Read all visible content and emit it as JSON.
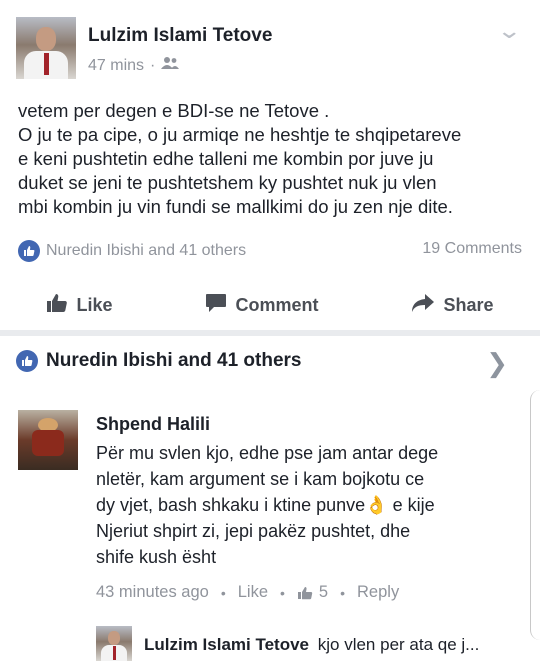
{
  "post": {
    "author": "Lulzim Islami Tetove",
    "time": "47 mins",
    "separator": "·",
    "text_lines": [
      "vetem per degen e BDI-se ne Tetove .",
      "O ju te pa cipe, o ju armiqe ne heshtje te shqipetareve",
      "e keni pushtetin edhe talleni me kombin por juve ju",
      "duket se jeni te pushtetshem   ky pushtet nuk ju vlen",
      "mbi kombin ju vin fundi se mallkimi do ju zen nje dite."
    ],
    "reactions_text": "Nuredin Ibishi and 41 others",
    "comments_count": "19 Comments"
  },
  "actions": {
    "like": "Like",
    "comment": "Comment",
    "share": "Share"
  },
  "likers": {
    "text": "Nuredin Ibishi and 41 others"
  },
  "comment": {
    "author": "Shpend Halili",
    "lines": [
      "Për mu svlen kjo, edhe pse jam antar dege",
      "nletër, kam argument se i kam bojkotu ce",
      "dy vjet, bash shkaku i ktine punve👌 e kije",
      "Njeriut shpirt zi, jepi pakëz pushtet, dhe",
      "shife kush ësht"
    ],
    "time": "43 minutes ago",
    "like_label": "Like",
    "like_count": "5",
    "reply_label": "Reply"
  },
  "reply": {
    "author": "Lulzim Islami Tetove",
    "text": "kjo vlen per ata qe j..."
  },
  "colors": {
    "brand_blue": "#4267b2",
    "text_primary": "#1d2129",
    "text_secondary": "#90949c"
  }
}
